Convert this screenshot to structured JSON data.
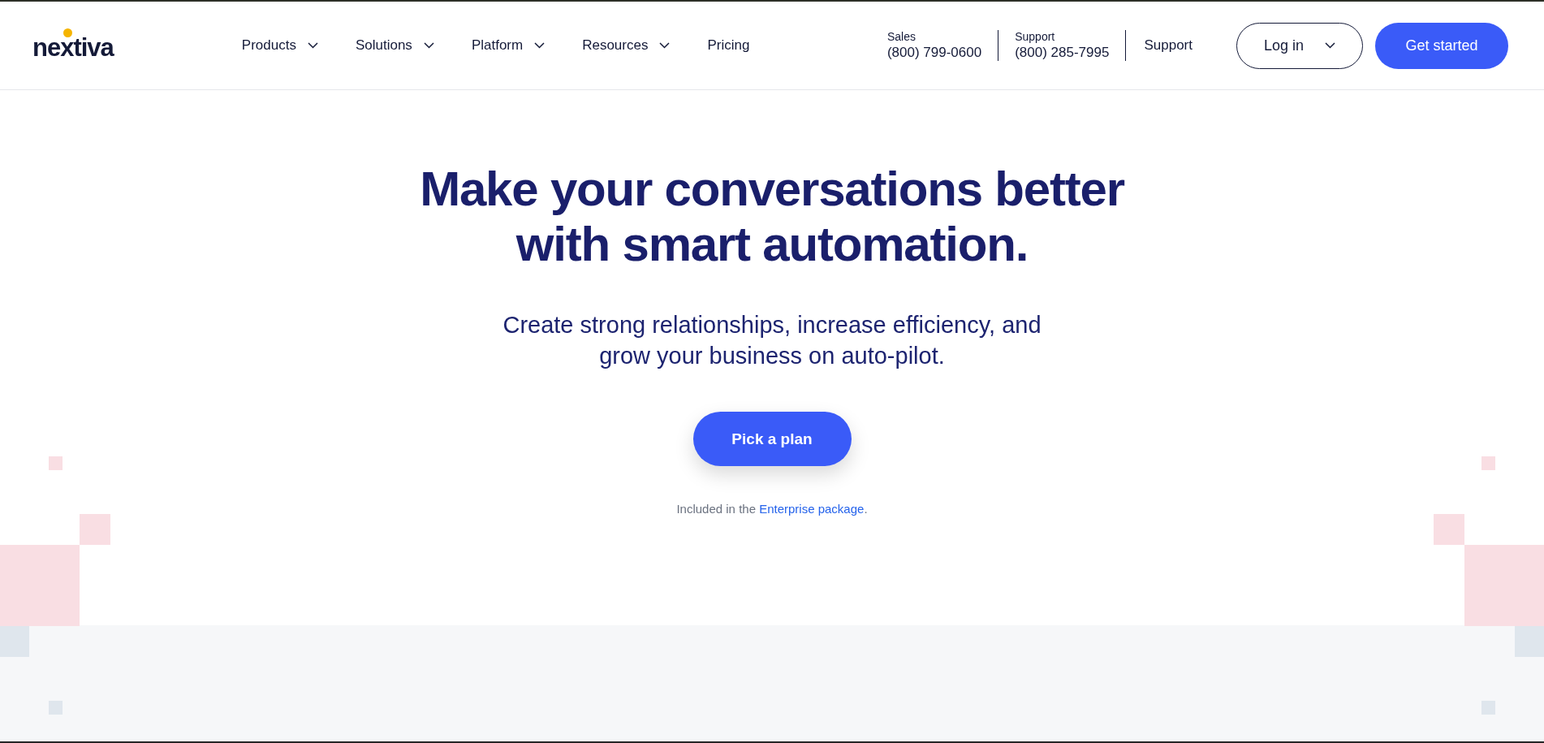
{
  "logo": {
    "text": "nextiva"
  },
  "nav": [
    {
      "label": "Products",
      "dropdown": true
    },
    {
      "label": "Solutions",
      "dropdown": true
    },
    {
      "label": "Platform",
      "dropdown": true
    },
    {
      "label": "Resources",
      "dropdown": true
    },
    {
      "label": "Pricing",
      "dropdown": false
    }
  ],
  "contacts": [
    {
      "label": "Sales",
      "phone": "(800) 799-0600"
    },
    {
      "label": "Support",
      "phone": "(800) 285-7995"
    }
  ],
  "support_link": "Support",
  "login_button": {
    "label": "Log in",
    "dropdown": true
  },
  "cta_button": "Get started",
  "hero": {
    "headline": [
      "Make your conversations better",
      "with smart automation."
    ],
    "subtitle": [
      "Create strong relationships, increase efficiency, and",
      "grow your business on auto-pilot."
    ],
    "button": "Pick a plan",
    "note": {
      "text": "Included in the",
      "link": "Enterprise package",
      "end": "."
    }
  }
}
